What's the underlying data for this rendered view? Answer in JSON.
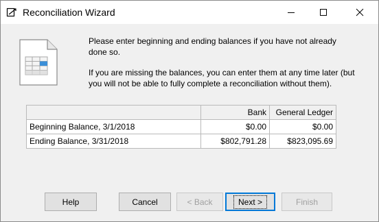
{
  "window": {
    "title": "Reconciliation Wizard"
  },
  "intro": {
    "paragraph1": "Please enter beginning and ending balances if you have not already done so.",
    "paragraph2": "If you are missing the balances, you can enter them at any time later (but you will not be able to fully complete a reconciliation without them)."
  },
  "balances": {
    "headers": [
      "",
      "Bank",
      "General Ledger"
    ],
    "rows": [
      {
        "label": "Beginning Balance, 3/1/2018",
        "bank": "$0.00",
        "ledger": "$0.00"
      },
      {
        "label": "Ending Balance, 3/31/2018",
        "bank": "$802,791.28",
        "ledger": "$823,095.69"
      }
    ]
  },
  "buttons": {
    "help": "Help",
    "cancel": "Cancel",
    "back": "< Back",
    "next": "Next >",
    "finish": "Finish"
  },
  "colors": {
    "titlebar": "#ffffff",
    "dialog_bg": "#f0f0f0",
    "default_button_border": "#0078d7"
  },
  "icons": [
    "app-icon",
    "minimize-icon",
    "maximize-icon",
    "close-icon",
    "spreadsheet-document-icon"
  ]
}
